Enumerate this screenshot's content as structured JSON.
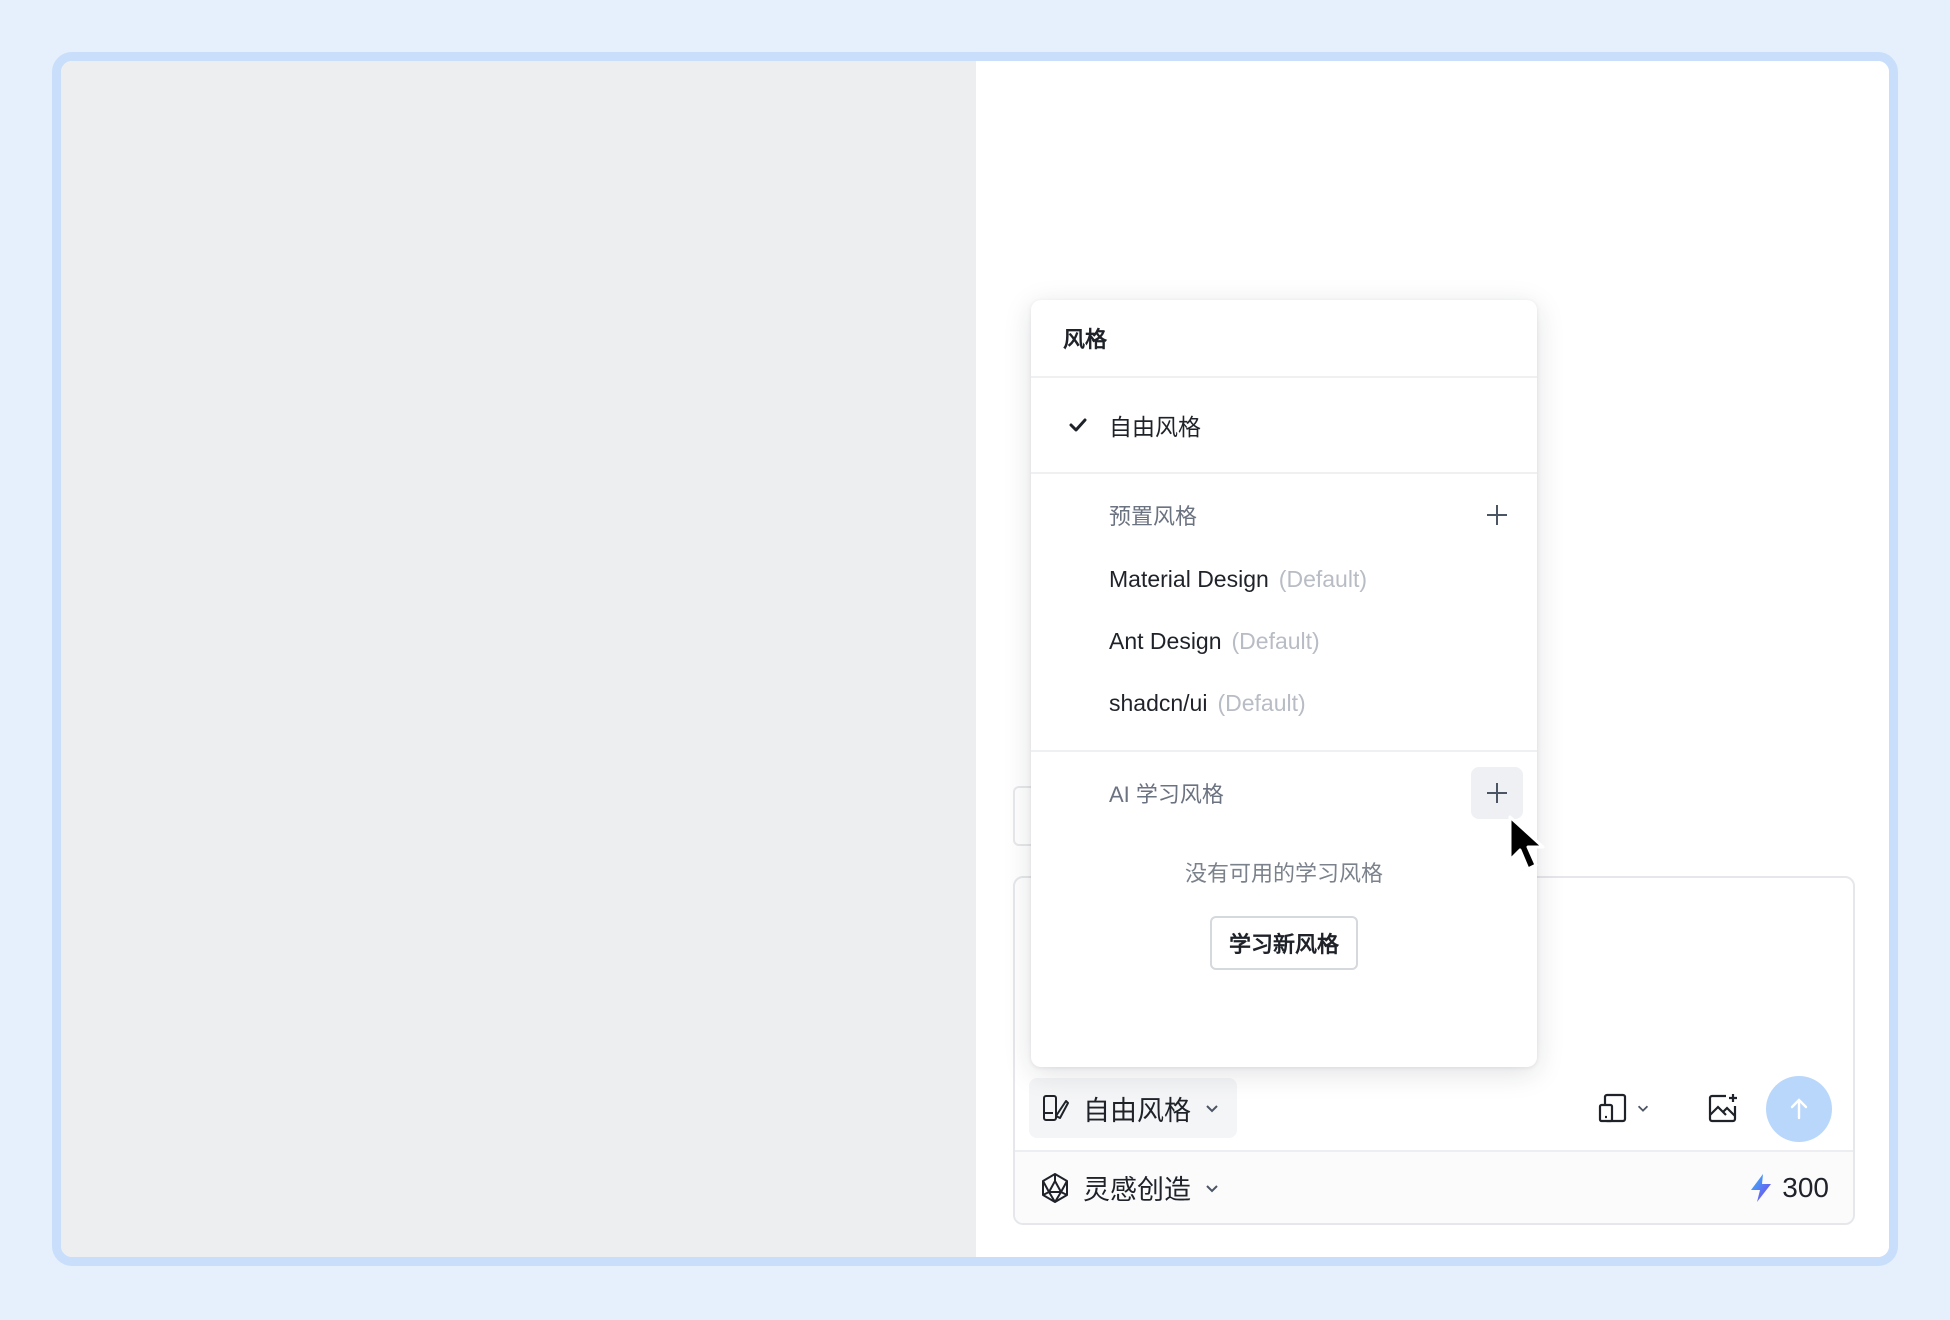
{
  "dropdown": {
    "title": "风格",
    "selected_option": "自由风格",
    "preset_section": {
      "title": "预置风格",
      "items": [
        {
          "name": "Material Design",
          "tag": "(Default)"
        },
        {
          "name": "Ant Design",
          "tag": "(Default)"
        },
        {
          "name": "shadcn/ui",
          "tag": "(Default)"
        }
      ]
    },
    "ai_section": {
      "title": "AI 学习风格",
      "empty_text": "没有可用的学习风格",
      "learn_button": "学习新风格"
    }
  },
  "chat_box": {
    "style_trigger_label": "自由风格",
    "mode_label": "灵感创造",
    "credits": "300"
  },
  "icons": {
    "check": "check-icon",
    "plus": "plus-icon",
    "style": "style-brush-icon",
    "chevron": "chevron-down-icon",
    "device": "device-icon",
    "image_add": "image-add-icon",
    "send": "arrow-up-icon",
    "mode": "polyhedron-icon",
    "credits": "lightning-icon",
    "cursor": "mouse-pointer-icon"
  },
  "colors": {
    "page_background": "#e6f0fd",
    "window_border": "#c8defb",
    "left_pane": "#edeef0",
    "send_button": "#b9d7fb",
    "muted_text": "#6b7280",
    "tag_text": "#b8bcc4"
  }
}
